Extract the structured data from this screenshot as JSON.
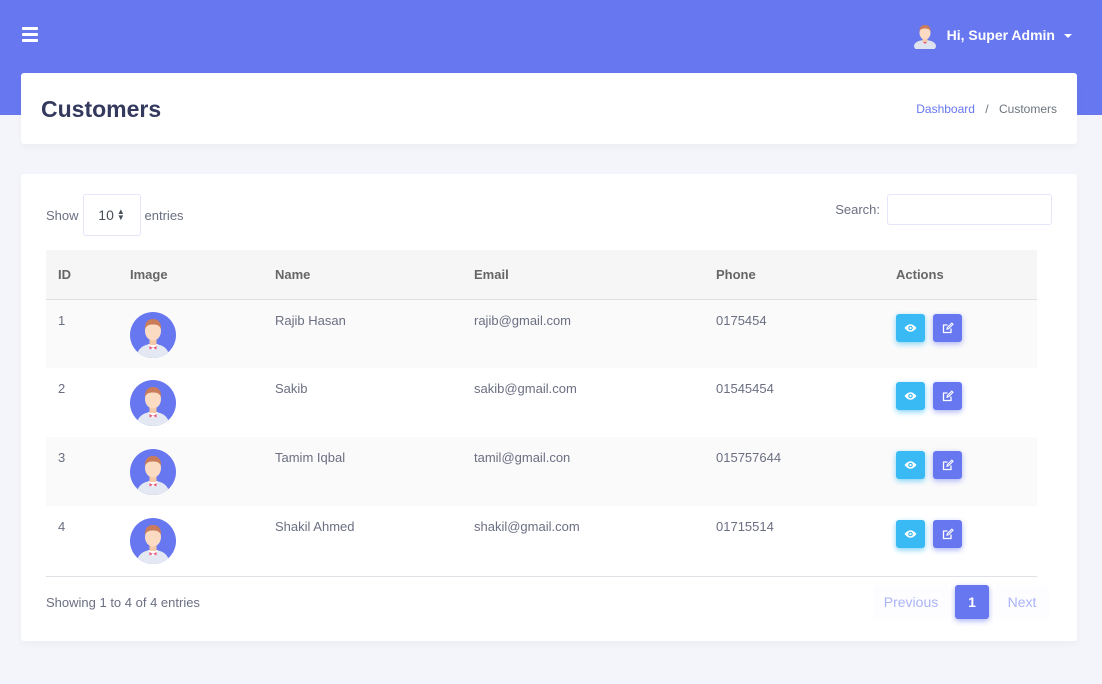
{
  "topbar": {
    "menu_icon": "hamburger-icon",
    "user_greeting": "Hi, Super Admin"
  },
  "header": {
    "title": "Customers",
    "breadcrumb": [
      {
        "label": "Dashboard"
      },
      {
        "label": "Customers"
      }
    ]
  },
  "table_controls": {
    "show_label": "Show",
    "entries_label": "entries",
    "page_length": "10",
    "search_label": "Search:",
    "search_value": "",
    "search_placeholder": ""
  },
  "table": {
    "columns": [
      "ID",
      "Image",
      "Name",
      "Email",
      "Phone",
      "Actions"
    ],
    "rows": [
      {
        "id": "1",
        "name": "Rajib Hasan",
        "email": "rajib@gmail.com",
        "phone": "0175454"
      },
      {
        "id": "2",
        "name": "Sakib",
        "email": "sakib@gmail.com",
        "phone": "01545454"
      },
      {
        "id": "3",
        "name": "Tamim Iqbal",
        "email": "tamil@gmail.con",
        "phone": "015757644"
      },
      {
        "id": "4",
        "name": "Shakil Ahmed",
        "email": "shakil@gmail.com",
        "phone": "01715514"
      }
    ]
  },
  "footer": {
    "info": "Showing 1 to 4 of 4 entries",
    "pagination": {
      "previous": "Previous",
      "current": "1",
      "next": "Next"
    }
  },
  "colors": {
    "primary": "#6777ef",
    "info": "#3abaf4",
    "title": "#34395e"
  }
}
